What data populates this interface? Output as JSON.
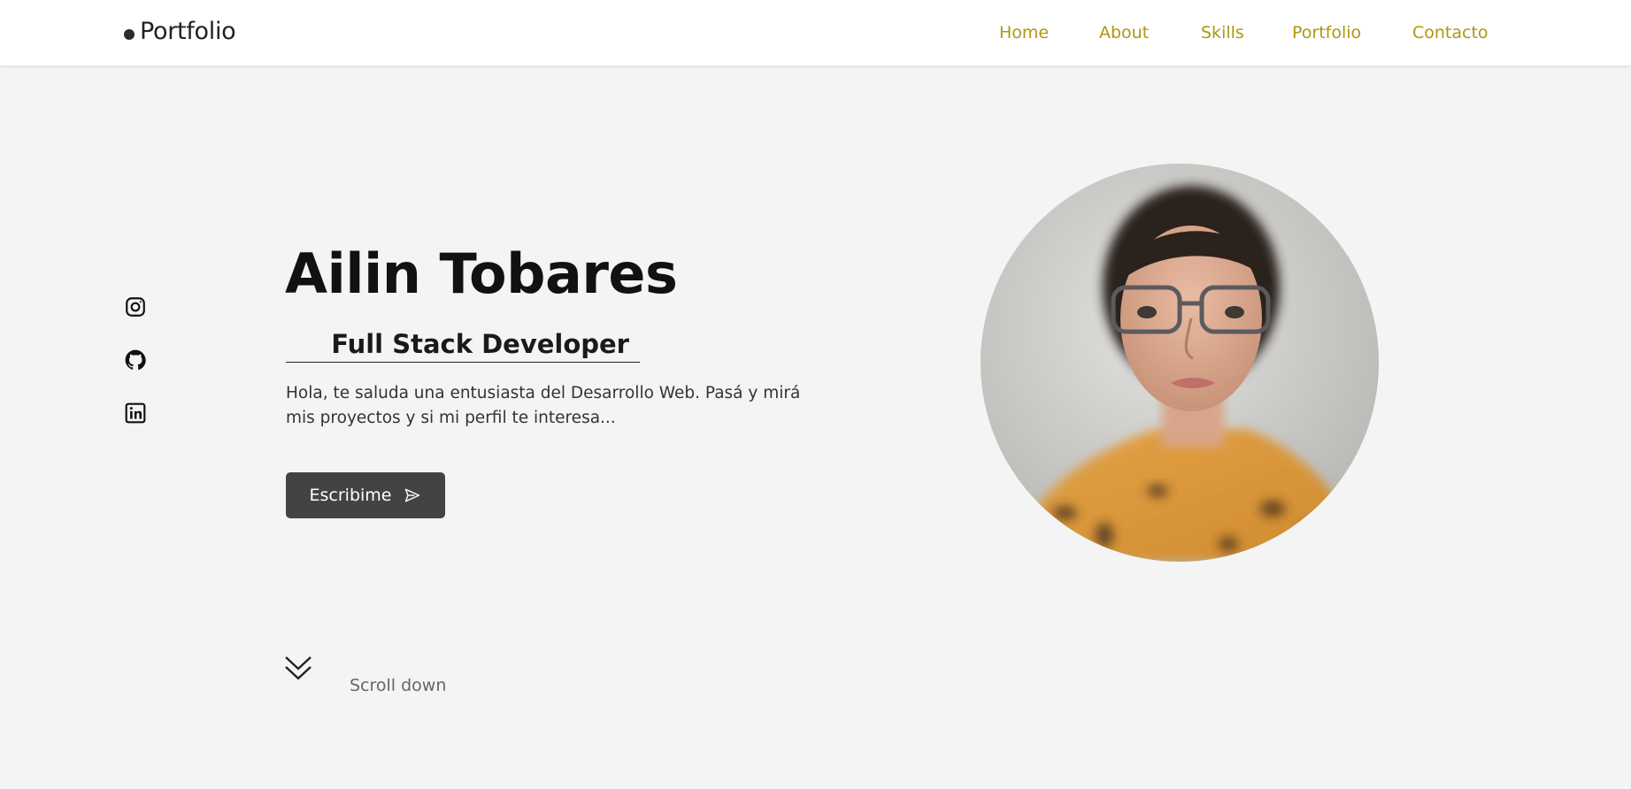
{
  "header": {
    "logo": "Portfolio",
    "nav": [
      {
        "label": "Home"
      },
      {
        "label": "About"
      },
      {
        "label": "Skills"
      },
      {
        "label": "Portfolio"
      },
      {
        "label": "Contacto"
      }
    ]
  },
  "social": [
    {
      "icon": "instagram-icon"
    },
    {
      "icon": "github-icon"
    },
    {
      "icon": "linkedin-icon"
    }
  ],
  "hero": {
    "name": "Ailin Tobares",
    "role": "Full Stack Developer",
    "intro": "Hola, te saluda una entusiasta del Desarrollo Web. Pasá y mirá mis proyectos y si mi perfil te interesa...",
    "cta_label": "Escribime",
    "cta_icon": "send-icon"
  },
  "scroll": {
    "label": "Scroll down",
    "icon": "double-chevron-down-icon"
  },
  "colors": {
    "accent": "#b0960f",
    "background": "#f4f4f4",
    "button": "#434343"
  }
}
